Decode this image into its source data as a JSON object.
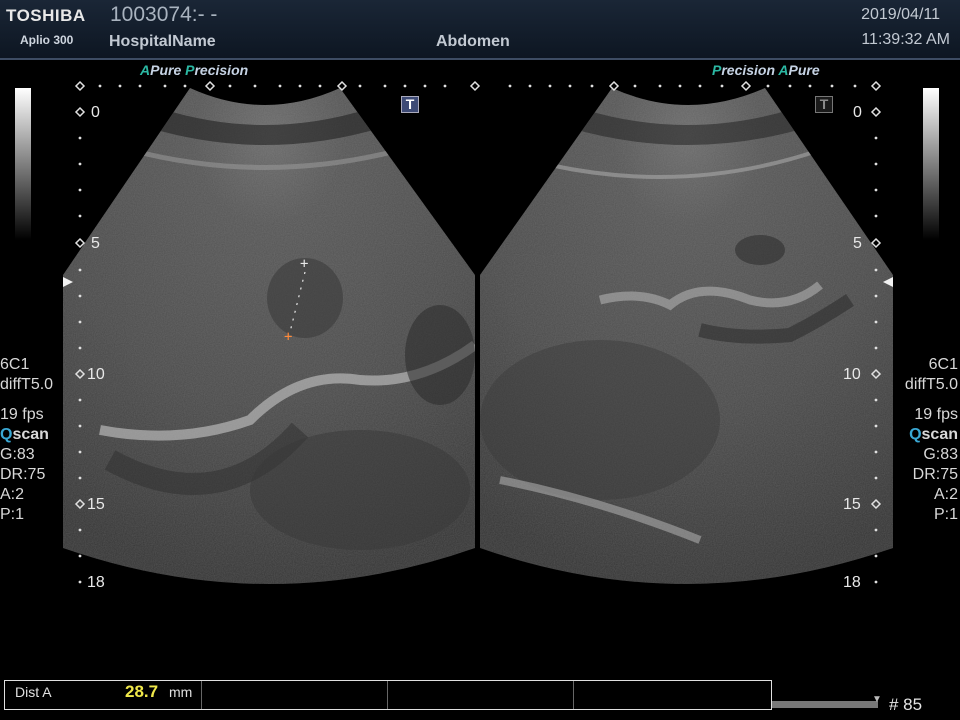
{
  "header": {
    "brand": "TOSHIBA",
    "model": "Aplio 300",
    "patient_id": "1003074:- -",
    "hospital": "HospitalName",
    "preset": "Abdomen",
    "date": "2019/04/11",
    "time": "11:39:32 AM"
  },
  "left_panel": {
    "tag_a": "A",
    "tag_pure": "Pure",
    "tag_p": "P",
    "tag_precision": "recision",
    "t_marker": "T",
    "depth_labels": [
      "0",
      "5",
      "10",
      "15",
      "18"
    ],
    "probe": "6C1",
    "mode": "diffT5.0",
    "fps": "19 fps",
    "q_letter": "Q",
    "q_rest": "scan",
    "gain": "G:83",
    "dr": "DR:75",
    "a": "A:2",
    "p": "P:1"
  },
  "right_panel": {
    "tag_p": "P",
    "tag_precision": "recision",
    "tag_a": "A",
    "tag_pure": "Pure",
    "t_marker": "T",
    "depth_labels": [
      "0",
      "5",
      "10",
      "15",
      "18"
    ],
    "probe": "6C1",
    "mode": "diffT5.0",
    "fps": "19 fps",
    "q_letter": "Q",
    "q_rest": "scan",
    "gain": "G:83",
    "dr": "DR:75",
    "a": "A:2",
    "p": "P:1"
  },
  "measurement": {
    "label": "Dist A",
    "value": "28.7",
    "unit": "mm"
  },
  "frame_counter": "# 85",
  "icons": {
    "cursor_start": "crosshair-icon",
    "cursor_end": "crosshair-icon",
    "focus_left": "focus-triangle-icon",
    "focus_right": "focus-triangle-icon"
  },
  "colors": {
    "accent_teal": "#2bb8a3",
    "measurement_value": "#f0e84a",
    "header_border": "#3d4c63"
  }
}
